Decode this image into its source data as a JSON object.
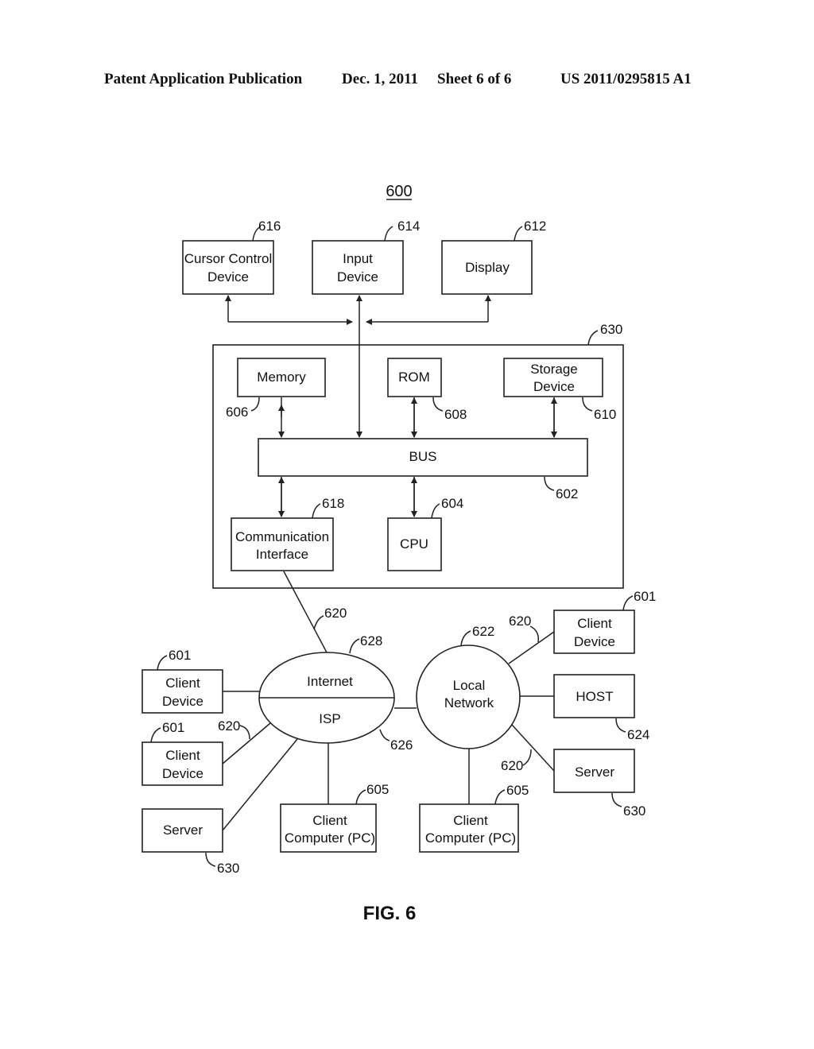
{
  "header": {
    "publication": "Patent Application Publication",
    "date": "Dec. 1, 2011",
    "sheet": "Sheet 6 of 6",
    "number": "US 2011/0295815 A1"
  },
  "figure": {
    "ref": "600",
    "caption": "FIG. 6",
    "peripherals": [
      {
        "label1": "Cursor Control",
        "label2": "Device",
        "ref": "616"
      },
      {
        "label1": "Input",
        "label2": "Device",
        "ref": "614"
      },
      {
        "label1": "Display",
        "label2": "",
        "ref": "612"
      }
    ],
    "system_ref": "630",
    "internal": {
      "memory": {
        "label": "Memory",
        "ref": "606"
      },
      "rom": {
        "label": "ROM",
        "ref": "608"
      },
      "storage": {
        "label1": "Storage",
        "label2": "Device",
        "ref": "610"
      },
      "bus": {
        "label": "BUS",
        "ref": "602"
      },
      "comm": {
        "label1": "Communication",
        "label2": "Interface",
        "ref": "618"
      },
      "cpu": {
        "label": "CPU",
        "ref": "604"
      }
    },
    "network": {
      "link_ref": "620",
      "internet": {
        "label": "Internet",
        "ref": "628"
      },
      "isp": {
        "label": "ISP",
        "ref": "626"
      },
      "local": {
        "label1": "Local",
        "label2": "Network",
        "ref": "622"
      },
      "left_nodes": [
        {
          "label1": "Client",
          "label2": "Device",
          "ref": "601"
        },
        {
          "label1": "Client",
          "label2": "Device",
          "ref": "601"
        },
        {
          "label1": "Server",
          "label2": "",
          "ref": "630"
        },
        {
          "label1": "Client",
          "label2": "Computer (PC)",
          "ref": "605"
        }
      ],
      "right_nodes": [
        {
          "label1": "Client",
          "label2": "Device",
          "ref": "601"
        },
        {
          "label1": "HOST",
          "label2": "",
          "ref": "624"
        },
        {
          "label1": "Server",
          "label2": "",
          "ref": "630"
        },
        {
          "label1": "Client",
          "label2": "Computer (PC)",
          "ref": "605"
        }
      ]
    }
  }
}
